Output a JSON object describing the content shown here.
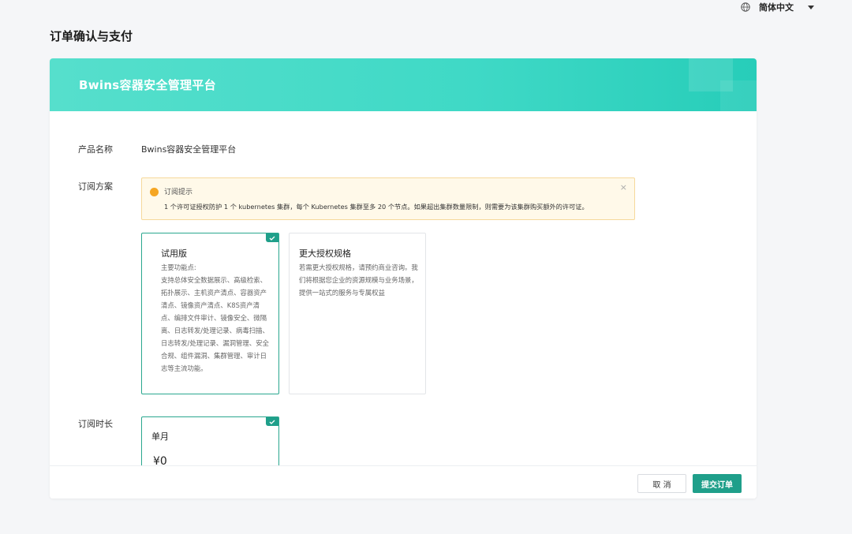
{
  "header": {
    "language": "简体中文",
    "language_icon": "globe-icon"
  },
  "page": {
    "title": "订单确认与支付"
  },
  "card": {
    "banner_title": "Bwins容器安全管理平台",
    "product": {
      "label": "产品名称",
      "value": "Bwins容器安全管理平台"
    },
    "subscription": {
      "label": "订阅方案",
      "notice": {
        "title": "订阅提示",
        "text": "1 个许可证授权防护 1 个 kubernetes 集群，每个 Kubernetes 集群至多 20 个节点。如果超出集群数量限制，则需要为该集群购买额外的许可证。",
        "close": "×"
      },
      "plans": [
        {
          "name": "试用版",
          "desc_title": "主要功能点:",
          "desc": "支持总体安全数据展示、高级检索、拓扑展示、主机资产清点、容器资产清点、镜像资产清点、K8S资产清点、编排文件审计、镜像安全、微隔离、日志转发/处理记录、病毒扫描、日志转发/处理记录、漏洞管理、安全合规、组件漏洞、集群管理、审计日志等主流功能。",
          "selected": true
        },
        {
          "name": "更大授权规格",
          "desc": "若需更大授权规格，请预约商业咨询。我们将根据您企业的资源规模与业务场景，提供一站式的服务与专属权益",
          "selected": false
        }
      ]
    },
    "duration": {
      "label": "订阅时长",
      "options": [
        {
          "name": "单月",
          "price": "¥0",
          "selected": true
        }
      ]
    }
  },
  "footer": {
    "cancel": "取 消",
    "submit": "提交订单"
  },
  "colors": {
    "accent": "#1f9f8a",
    "banner": "#3fd9c6",
    "notice_bg": "#fff9e9"
  }
}
